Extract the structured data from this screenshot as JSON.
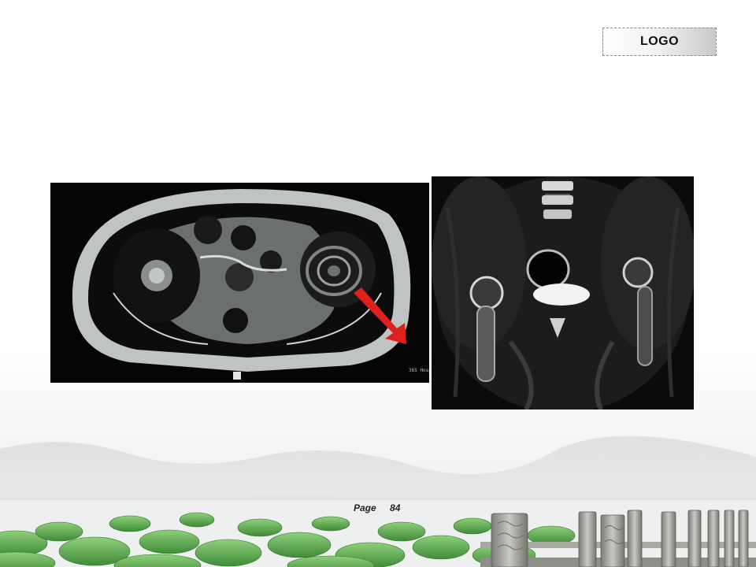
{
  "logo": {
    "text": "LOGO"
  },
  "footer": {
    "page_label": "Page",
    "page_number": "84"
  },
  "scans": {
    "axial_caption": "365 Hospital •\n         5 Jun"
  },
  "colors": {
    "arrow": "#e0201c",
    "lotus_leaf": "#5aa84a",
    "stone": "#9c9c98"
  }
}
